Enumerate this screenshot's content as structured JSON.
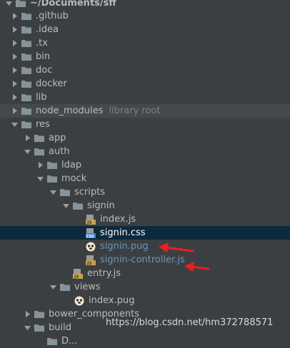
{
  "project_path": "~/Documents/sff",
  "tree": [
    {
      "label": "~/Documents/sff",
      "bold": true
    },
    {
      "label": ".github"
    },
    {
      "label": ".idea"
    },
    {
      "label": ".tx"
    },
    {
      "label": "bin"
    },
    {
      "label": "doc"
    },
    {
      "label": "docker"
    },
    {
      "label": "lib"
    },
    {
      "label": "node_modules",
      "suffix": "library root"
    },
    {
      "label": "res"
    },
    {
      "label": "app"
    },
    {
      "label": "auth"
    },
    {
      "label": "ldap"
    },
    {
      "label": "mock"
    },
    {
      "label": "scripts"
    },
    {
      "label": "signin"
    },
    {
      "label": "index.js"
    },
    {
      "label": "signin.css"
    },
    {
      "label": "signin.pug"
    },
    {
      "label": "signin-controller.js"
    },
    {
      "label": "entry.js"
    },
    {
      "label": "views"
    },
    {
      "label": "index.pug"
    },
    {
      "label": "bower_components"
    },
    {
      "label": "build"
    },
    {
      "label": "D..."
    }
  ],
  "watermark": "https://blog.csdn.net/hm372788571",
  "colors": {
    "panel_bg": "#3c3f41",
    "selected_row": "#0d293e",
    "library_row": "#45494a",
    "folder": "#87939a",
    "js_icon": "#c6a24e",
    "css_icon": "#4a86c8",
    "annotation_arrow": "#e8211e",
    "modified_text": "#6897bb"
  }
}
